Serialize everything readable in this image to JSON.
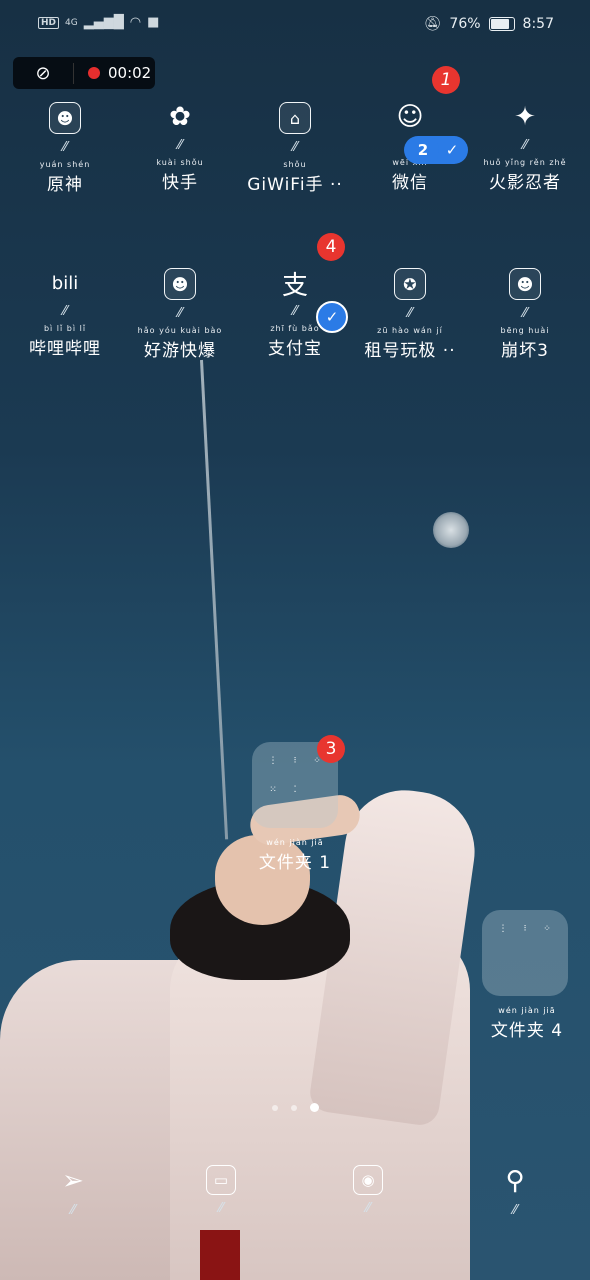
{
  "status_bar": {
    "hd": "HD",
    "network": "4G",
    "battery": "76%",
    "battery_level": 0.76,
    "time": "8:57"
  },
  "recording": {
    "timer": "00:02"
  },
  "row1": [
    {
      "pinyin": "yuán shén",
      "label": "原神",
      "icon": "genshin-icon",
      "glyph": "☻"
    },
    {
      "pinyin": "kuài shǒu",
      "label": "快手",
      "icon": "kuaishou-icon",
      "glyph": "✿"
    },
    {
      "pinyin": "shǒu",
      "label": "GiWiFi手 ··",
      "icon": "giwifi-icon",
      "glyph": "⌂"
    },
    {
      "pinyin": "wēi xìn",
      "label": "微信",
      "icon": "wechat-icon",
      "glyph": "☺"
    },
    {
      "pinyin": "huǒ yǐng rěn zhě",
      "label": "火影忍者",
      "icon": "naruto-icon",
      "glyph": "✦"
    }
  ],
  "row2": [
    {
      "pinyin": "bì lǐ bì lǐ",
      "label": "哔哩哔哩",
      "icon": "bilibili-icon",
      "glyph": "bili"
    },
    {
      "pinyin": "hǎo yóu kuài bào",
      "label": "好游快爆",
      "icon": "haoyou-icon",
      "glyph": "☻"
    },
    {
      "pinyin": "zhī fù bǎo",
      "label": "支付宝",
      "icon": "alipay-icon",
      "glyph": "支"
    },
    {
      "pinyin": "zū hào wán jí",
      "label": "租号玩极 ··",
      "icon": "zuhao-icon",
      "glyph": "✪"
    },
    {
      "pinyin": "bēng huài",
      "label": "崩坏3",
      "icon": "honkai-icon",
      "glyph": "☻"
    }
  ],
  "badges": {
    "wechat": "1",
    "alipay": "4",
    "folder1": "3",
    "dual_app": "2"
  },
  "folders": [
    {
      "pinyin": "wén jiàn jiā",
      "label": "文件夹 1",
      "items": [
        "⋮",
        "⁝",
        "⁘",
        "⁙",
        "⁚",
        ""
      ]
    },
    {
      "pinyin": "wén jiàn jiā",
      "label": "文件夹 4",
      "items": [
        "⋮",
        "⁝",
        "⁘"
      ]
    }
  ],
  "pager": {
    "pages": 3,
    "current": 3
  },
  "dock": [
    {
      "icon": "send-icon",
      "glyph": "➢"
    },
    {
      "icon": "subtitle-icon",
      "glyph": "▭"
    },
    {
      "icon": "camera-app-icon",
      "glyph": "◉"
    },
    {
      "icon": "hairdryer-icon",
      "glyph": "⚲"
    }
  ]
}
